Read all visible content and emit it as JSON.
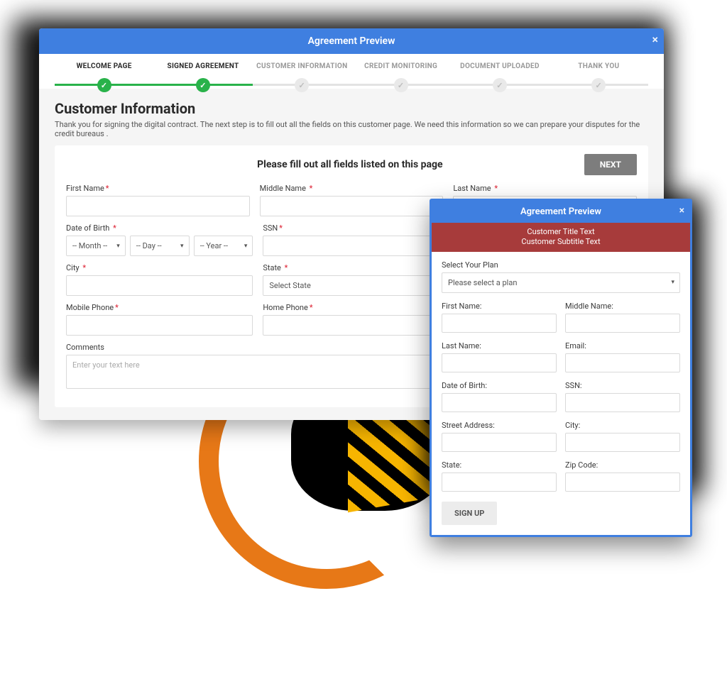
{
  "win1": {
    "title": "Agreement Preview",
    "close_icon": "×",
    "steps": [
      {
        "label": "WELCOME PAGE",
        "state": "done"
      },
      {
        "label": "SIGNED AGREEMENT",
        "state": "done"
      },
      {
        "label": "CUSTOMER INFORMATION",
        "state": "pending"
      },
      {
        "label": "CREDIT MONITORING",
        "state": "pending"
      },
      {
        "label": "DOCUMENT UPLOADED",
        "state": "pending"
      },
      {
        "label": "THANK YOU",
        "state": "pending"
      }
    ],
    "section_title": "Customer Information",
    "section_sub": "Thank you for signing the digital contract. The next step is to fill out all the fields on this customer page. We need this information so we can prepare your disputes for the credit bureaus .",
    "form_top": "Please fill out all fields listed on this page",
    "next": "NEXT",
    "fields": {
      "first_name": "First Name",
      "middle_name": "Middle Name",
      "last_name": "Last Name",
      "dob": "Date of Birth",
      "dob_month": "-- Month --",
      "dob_day": "-- Day --",
      "dob_year": "-- Year --",
      "ssn": "SSN",
      "city": "City",
      "state": "State",
      "state_placeholder": "Select State",
      "mobile": "Mobile Phone",
      "home": "Home Phone",
      "comments": "Comments",
      "comments_placeholder": "Enter your text here",
      "required": "*"
    }
  },
  "win2": {
    "title": "Agreement Preview",
    "close_icon": "×",
    "banner_title": "Customer Title Text",
    "banner_sub": "Customer Subtitle Text",
    "plan_label": "Select Your Plan",
    "plan_placeholder": "Please select a plan",
    "fields": {
      "first_name": "First Name:",
      "middle_name": "Middle Name:",
      "last_name": "Last Name:",
      "email": "Email:",
      "dob": "Date of Birth:",
      "ssn": "SSN:",
      "street": "Street Address:",
      "city": "City:",
      "state": "State:",
      "zip": "Zip Code:"
    },
    "signup": "SIGN UP"
  }
}
